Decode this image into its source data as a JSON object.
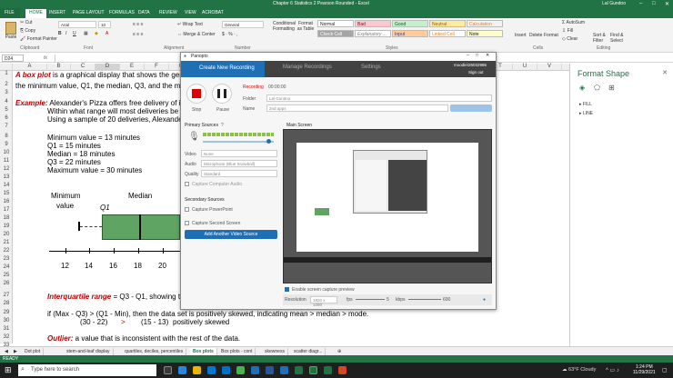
{
  "window": {
    "title": "Chapter 6 Statistics 2 Pearson Rounded - Excel",
    "user": "Lal Gundoo"
  },
  "ribbon": {
    "file_tab": "FILE",
    "tabs": [
      "HOME",
      "INSERT",
      "PAGE LAYOUT",
      "FORMULAS",
      "DATA",
      "REVIEW",
      "VIEW",
      "ACROBAT"
    ],
    "clipboard": {
      "cut": "Cut",
      "copy": "Copy",
      "format_painter": "Format Painter",
      "paste": "Paste",
      "group": "Clipboard"
    },
    "font": {
      "name": "Arial",
      "size": "10",
      "group": "Font"
    },
    "alignment": {
      "wrap": "Wrap Text",
      "merge": "Merge & Center",
      "group": "Alignment"
    },
    "number": {
      "format": "General",
      "group": "Number"
    },
    "styles": {
      "conditional": "Conditional Formatting",
      "format_table": "Format as Table",
      "normal": "Normal",
      "bad": "Bad",
      "good": "Good",
      "neutral": "Neutral",
      "calculation": "Calculation",
      "check_cell": "Check Cell",
      "explanatory": "Explanatory ...",
      "input": "Input",
      "linked_cell": "Linked Cell",
      "note": "Note",
      "group": "Styles"
    },
    "cells": {
      "insert": "Insert",
      "delete": "Delete",
      "format": "Format",
      "group": "Cells"
    },
    "editing": {
      "autosum": "AutoSum",
      "fill": "Fill",
      "clear": "Clear",
      "sort": "Sort & Filter",
      "find": "Find & Select",
      "group": "Editing"
    }
  },
  "formula_bar": {
    "name_box": "D24",
    "fx": "fx"
  },
  "columns": [
    "A",
    "B",
    "C",
    "D",
    "E",
    "F",
    "G",
    "H",
    "I",
    "J",
    "K",
    "L",
    "M",
    "N",
    "O",
    "P",
    "Q",
    "R",
    "S",
    "T",
    "U",
    "V"
  ],
  "rows": [
    "1",
    "2",
    "3",
    "4",
    "5",
    "6",
    "7",
    "8",
    "9",
    "10",
    "11",
    "12",
    "13",
    "14",
    "15",
    "16",
    "17",
    "18",
    "19",
    "20",
    "21",
    "22",
    "23",
    "24",
    "25",
    "26",
    "27",
    "28",
    "29",
    "30",
    "31",
    "32",
    "33"
  ],
  "sheet": {
    "r1_term": "A box plot",
    "r1_rest": " is a graphical display that shows the genera",
    "r2": "the minimum value, Q1, the median, Q3, and the maxim",
    "r4_label": "Example:",
    "r4_rest": " Alexander's Pizza offers free delivery of its p",
    "r5": "Within what range will most deliveries be con",
    "r6": "Using a sample of 20 deliveries, Alexander d",
    "r8": "Minimum value = 13 minutes",
    "r9": "Q1 = 15 minutes",
    "r10": "Median = 18 minutes",
    "r11": "Q3 = 22 minutes",
    "r12": "Maximum value = 30 minutes",
    "r27_term": "Interquartile range",
    "r27_rest": " = Q3 - Q1, showing the",
    "r29": "if (Max - Q3) > (Q1 - Min), then the data set is positively skewed, indicating mean > median > mode.",
    "r30_a": "(30 - 22)",
    "r30_gt": ">",
    "r30_b": "(15 - 13)",
    "r30_c": "positively skewed",
    "r32_term": "Outlier:",
    "r32_rest": " a value that is inconsistent with the rest of the data."
  },
  "boxplot": {
    "min_label_1": "Minimum",
    "min_label_2": "value",
    "q1_label": "Q1",
    "median_label": "Median",
    "ticks": [
      "12",
      "14",
      "16",
      "18",
      "20"
    ]
  },
  "sheet_tabs": [
    "Dot plot",
    "stem-and-leaf display",
    "quartiles, deciles, percentiles",
    "Box plots",
    "Box plots - cont",
    "skewness",
    "scatter diagr..."
  ],
  "active_sheet": "Box plots",
  "status": {
    "left": "READY"
  },
  "format_pane": {
    "title": "Format Shape",
    "fill": "FILL",
    "line": "LINE"
  },
  "panopto": {
    "app_name": "Panopto",
    "tabs": {
      "create": "Create New Recording",
      "manage": "Manage Recordings",
      "settings": "Settings"
    },
    "account": "moodle\\26032986",
    "sign_out": "Sign out",
    "recording_label": "Recording",
    "timer": "00:00:00",
    "stop": "Stop",
    "pause": "Pause",
    "folder_label": "Folder",
    "folder_value": "Lal Gundoo",
    "name_label": "Name",
    "name_value": "2nd apps",
    "primary_sources": "Primary Sources",
    "video_label": "Video",
    "video_value": "None",
    "audio_label": "Audio",
    "audio_value": "Microphone (Blue Snowball)",
    "quality_label": "Quality",
    "quality_value": "Standard",
    "capture_computer_audio": "Capture Computer Audio",
    "secondary_sources": "Secondary Sources",
    "capture_powerpoint": "Capture PowerPoint",
    "capture_second_screen": "Capture Second Screen",
    "add_video_source": "Add Another Video Source",
    "main_screen": "Main Screen",
    "enable_preview": "Enable screen capture preview",
    "resolution_label": "Resolution",
    "resolution_value": "1920 x 1080",
    "fps_label": "fps",
    "fps_value": "5",
    "kbps_label": "kbps",
    "kbps_value": "600"
  },
  "taskbar": {
    "search": "Type here to search",
    "weather": "63°F Cloudy",
    "time": "1:24 PM",
    "date": "11/29/2021"
  },
  "colors": {
    "excel_green": "#217346",
    "panopto_blue": "#1f6fb5",
    "box_green": "#5fa463"
  }
}
